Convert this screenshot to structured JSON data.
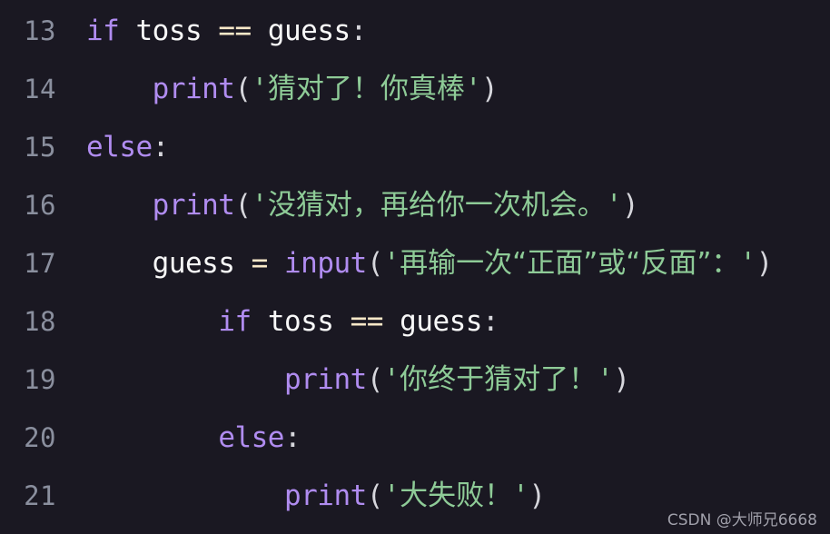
{
  "editor": {
    "language": "python",
    "theme": "dark",
    "background_color": "#1a1822",
    "line_number_color": "#8a8f9e",
    "colors": {
      "keyword": "#b08cf0",
      "function": "#b08cf0",
      "string": "#8ecb97",
      "operator": "#f8e8c8",
      "punctuation": "#d6d6dc",
      "identifier": "#f8f8f8"
    },
    "first_line_number": 13,
    "last_line_number": 21,
    "lines": [
      {
        "number": "13",
        "indent": "",
        "text": "if toss == guess:",
        "tokens": {
          "kw": "if",
          "sp1": " ",
          "name1": "toss",
          "sp2": " ",
          "op": "==",
          "sp3": " ",
          "name2": "guess",
          "colon": ":"
        }
      },
      {
        "number": "14",
        "indent": "    ",
        "text": "print('猜对了！你真棒')",
        "tokens": {
          "func": "print",
          "lparen": "(",
          "quote_open": "'",
          "string": "猜对了！你真棒",
          "quote_close": "'",
          "rparen": ")"
        }
      },
      {
        "number": "15",
        "indent": "",
        "text": "else:",
        "tokens": {
          "kw": "else",
          "colon": ":"
        }
      },
      {
        "number": "16",
        "indent": "    ",
        "text": "print('没猜对，再给你一次机会。')",
        "tokens": {
          "func": "print",
          "lparen": "(",
          "quote_open": "'",
          "string": "没猜对，再给你一次机会。",
          "quote_close": "'",
          "rparen": ")"
        }
      },
      {
        "number": "17",
        "indent": "    ",
        "text": "guess = input('再输一次“正面”或“反面”：')",
        "tokens": {
          "name1": "guess",
          "sp1": " ",
          "op": "=",
          "sp2": " ",
          "func": "input",
          "lparen": "(",
          "quote_open": "'",
          "string": "再输一次“正面”或“反面”：",
          "quote_close": "'",
          "rparen": ")"
        }
      },
      {
        "number": "18",
        "indent": "        ",
        "text": "if toss == guess:",
        "tokens": {
          "kw": "if",
          "sp1": " ",
          "name1": "toss",
          "sp2": " ",
          "op": "==",
          "sp3": " ",
          "name2": "guess",
          "colon": ":"
        }
      },
      {
        "number": "19",
        "indent": "            ",
        "text": "print('你终于猜对了！')",
        "tokens": {
          "func": "print",
          "lparen": "(",
          "quote_open": "'",
          "string": "你终于猜对了！",
          "quote_close": "'",
          "rparen": ")"
        }
      },
      {
        "number": "20",
        "indent": "        ",
        "text": "else:",
        "tokens": {
          "kw": "else",
          "colon": ":"
        }
      },
      {
        "number": "21",
        "indent": "            ",
        "text": "print('大失败！')",
        "tokens": {
          "func": "print",
          "lparen": "(",
          "quote_open": "'",
          "string": "大失败！",
          "quote_close": "'",
          "rparen": ")"
        }
      }
    ]
  },
  "watermark": {
    "text": "CSDN @大师兄6668"
  }
}
